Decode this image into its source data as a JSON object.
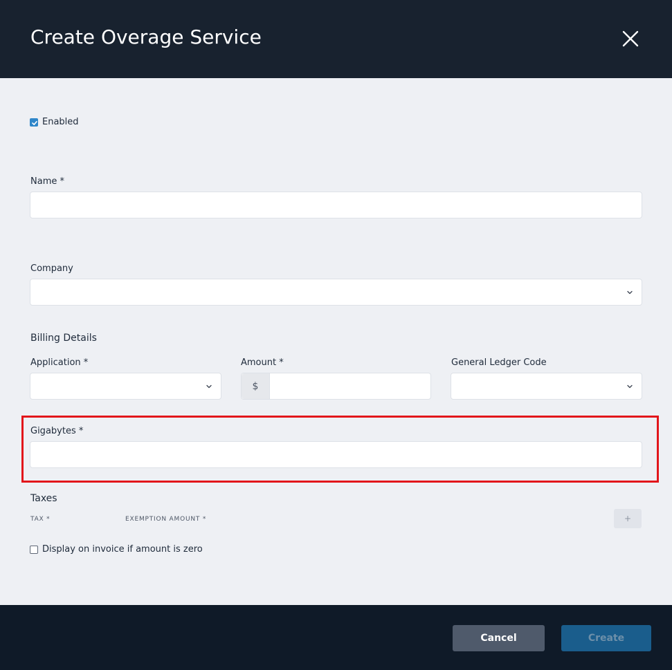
{
  "header": {
    "title": "Create Overage Service"
  },
  "form": {
    "enabled_label": "Enabled",
    "enabled_checked": true,
    "name_label": "Name *",
    "name_value": "",
    "company_label": "Company",
    "company_value": "",
    "billing_details_title": "Billing Details",
    "application_label": "Application *",
    "application_value": "",
    "amount_label": "Amount *",
    "amount_prefix": "$",
    "amount_value": "",
    "gl_code_label": "General Ledger Code",
    "gl_code_value": "",
    "gigabytes_label": "Gigabytes *",
    "gigabytes_value": "",
    "taxes_title": "Taxes",
    "tax_col_label": "TAX *",
    "exemption_col_label": "EXEMPTION AMOUNT *",
    "add_tax_label": "+",
    "display_zero_label": "Display on invoice if amount is zero",
    "display_zero_checked": false
  },
  "footer": {
    "cancel_label": "Cancel",
    "create_label": "Create"
  },
  "colors": {
    "header_bg": "#18222f",
    "body_bg": "#eef0f4",
    "footer_bg": "#0f1a28",
    "accent": "#2f86c9",
    "highlight": "#e2161b",
    "cancel_bg": "#4f5a6b",
    "create_bg": "#1a5d8c"
  },
  "icons": {
    "close": "close-icon",
    "checkbox": "check-icon",
    "dropdown": "chevron-down-icon"
  }
}
